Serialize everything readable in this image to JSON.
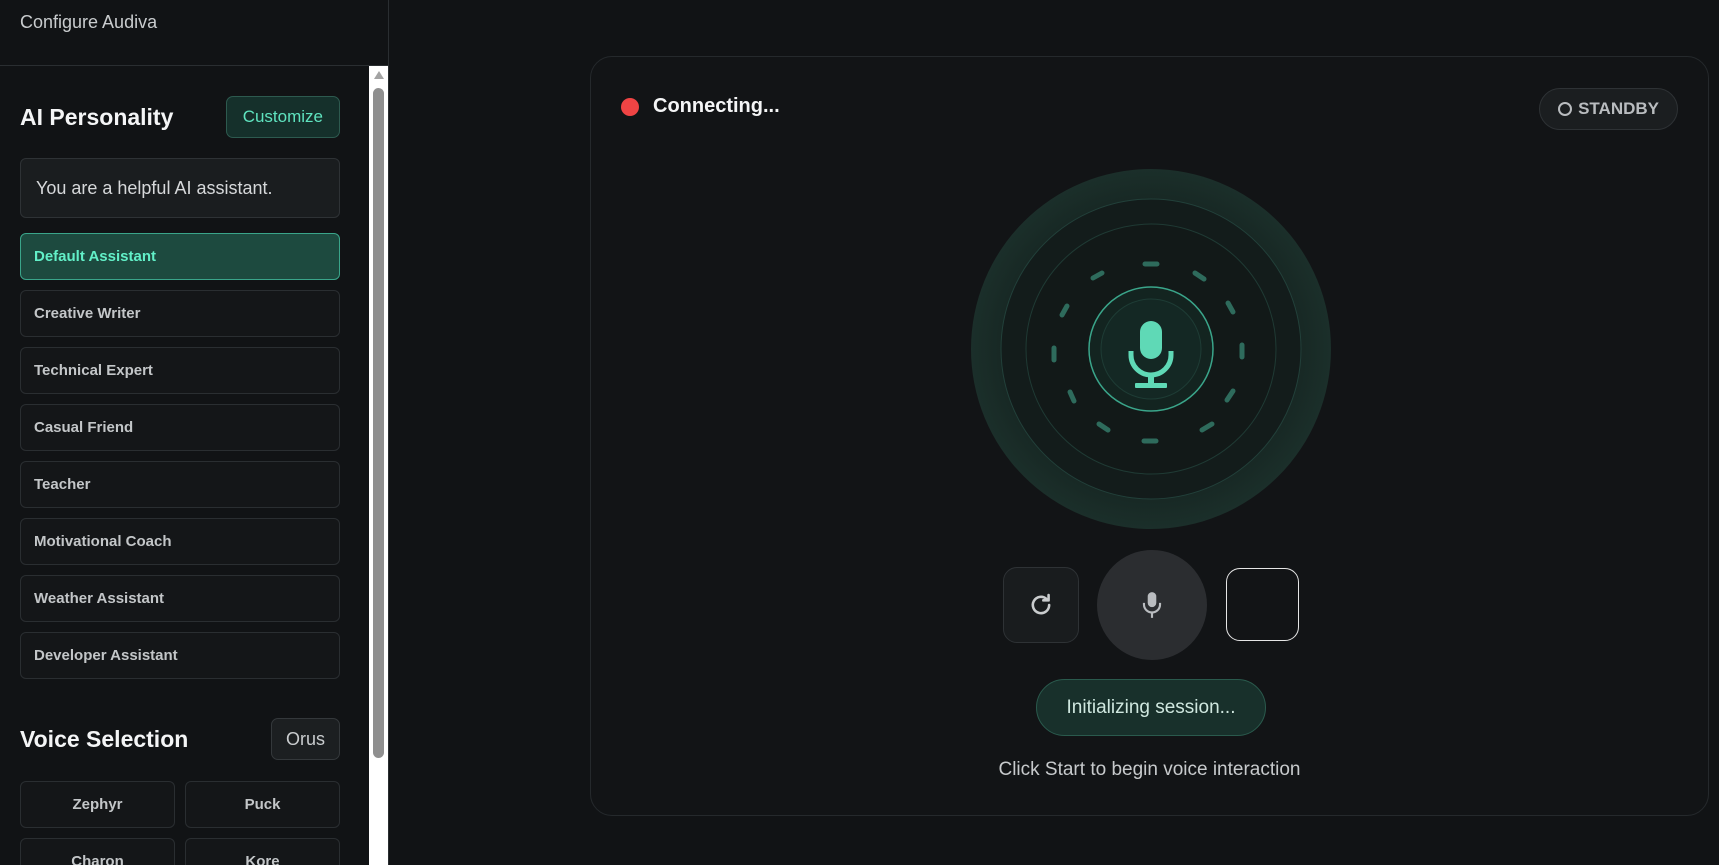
{
  "sidebar": {
    "header": "Configure Audiva",
    "personality": {
      "title": "AI Personality",
      "customize_label": "Customize",
      "prompt": "You are a helpful AI assistant.",
      "presets": [
        "Default Assistant",
        "Creative Writer",
        "Technical Expert",
        "Casual Friend",
        "Teacher",
        "Motivational Coach",
        "Weather Assistant",
        "Developer Assistant"
      ],
      "selected": "Default Assistant"
    },
    "voice": {
      "title": "Voice Selection",
      "current": "Orus",
      "options": [
        "Zephyr",
        "Puck",
        "Charon",
        "Kore"
      ]
    }
  },
  "main": {
    "status_text": "Connecting...",
    "status_color": "#ef4444",
    "mode_badge": "STANDBY",
    "session_status": "Initializing session...",
    "hint": "Click Start to begin voice interaction"
  },
  "colors": {
    "accent": "#5fe3bf",
    "background": "#111315"
  }
}
